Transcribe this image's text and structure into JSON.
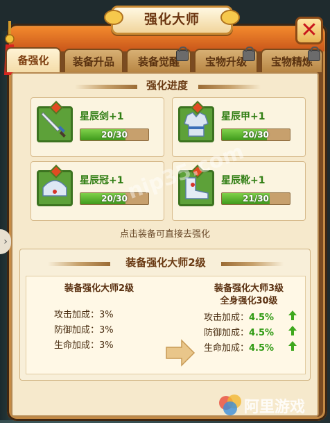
{
  "window": {
    "title": "强化大师",
    "close_label": "✕"
  },
  "tabs": [
    {
      "label": "备强化",
      "active": true,
      "locked": false
    },
    {
      "label": "装备升品",
      "active": false,
      "locked": false
    },
    {
      "label": "装备觉醒",
      "active": false,
      "locked": true
    },
    {
      "label": "宝物升级",
      "active": false,
      "locked": true
    },
    {
      "label": "宝物精炼",
      "active": false,
      "locked": true
    }
  ],
  "progress_section": {
    "title": "强化进度"
  },
  "equipment": [
    {
      "name": "星辰剑+1",
      "progress": "20/30",
      "fill": 0.667,
      "icon": "sword-icon"
    },
    {
      "name": "星辰甲+1",
      "progress": "20/30",
      "fill": 0.667,
      "icon": "armor-icon"
    },
    {
      "name": "星辰冠+1",
      "progress": "20/30",
      "fill": 0.667,
      "icon": "helmet-icon"
    },
    {
      "name": "星辰靴+1",
      "progress": "21/30",
      "fill": 0.7,
      "icon": "boots-icon"
    }
  ],
  "hint": "点击装备可直接去强化",
  "master": {
    "title": "装备强化大师2级",
    "current": {
      "title": "装备强化大师2级",
      "stats": [
        {
          "label": "攻击加成：",
          "value": "3%"
        },
        {
          "label": "防御加成：",
          "value": "3%"
        },
        {
          "label": "生命加成：",
          "value": "3%"
        }
      ]
    },
    "next": {
      "title": "装备强化大师3级",
      "requirement": "全身强化30级",
      "stats": [
        {
          "label": "攻击加成：",
          "value": "4.5%"
        },
        {
          "label": "防御加成：",
          "value": "4.5%"
        },
        {
          "label": "生命加成：",
          "value": "4.5%"
        }
      ]
    }
  },
  "colors": {
    "accent": "#f38a2d",
    "green_text": "#2f7d12",
    "bar_fill": "#5fb532",
    "close_red": "#c8151b"
  },
  "watermarks": {
    "center": "nip35.com",
    "corner": "阿里游戏"
  }
}
